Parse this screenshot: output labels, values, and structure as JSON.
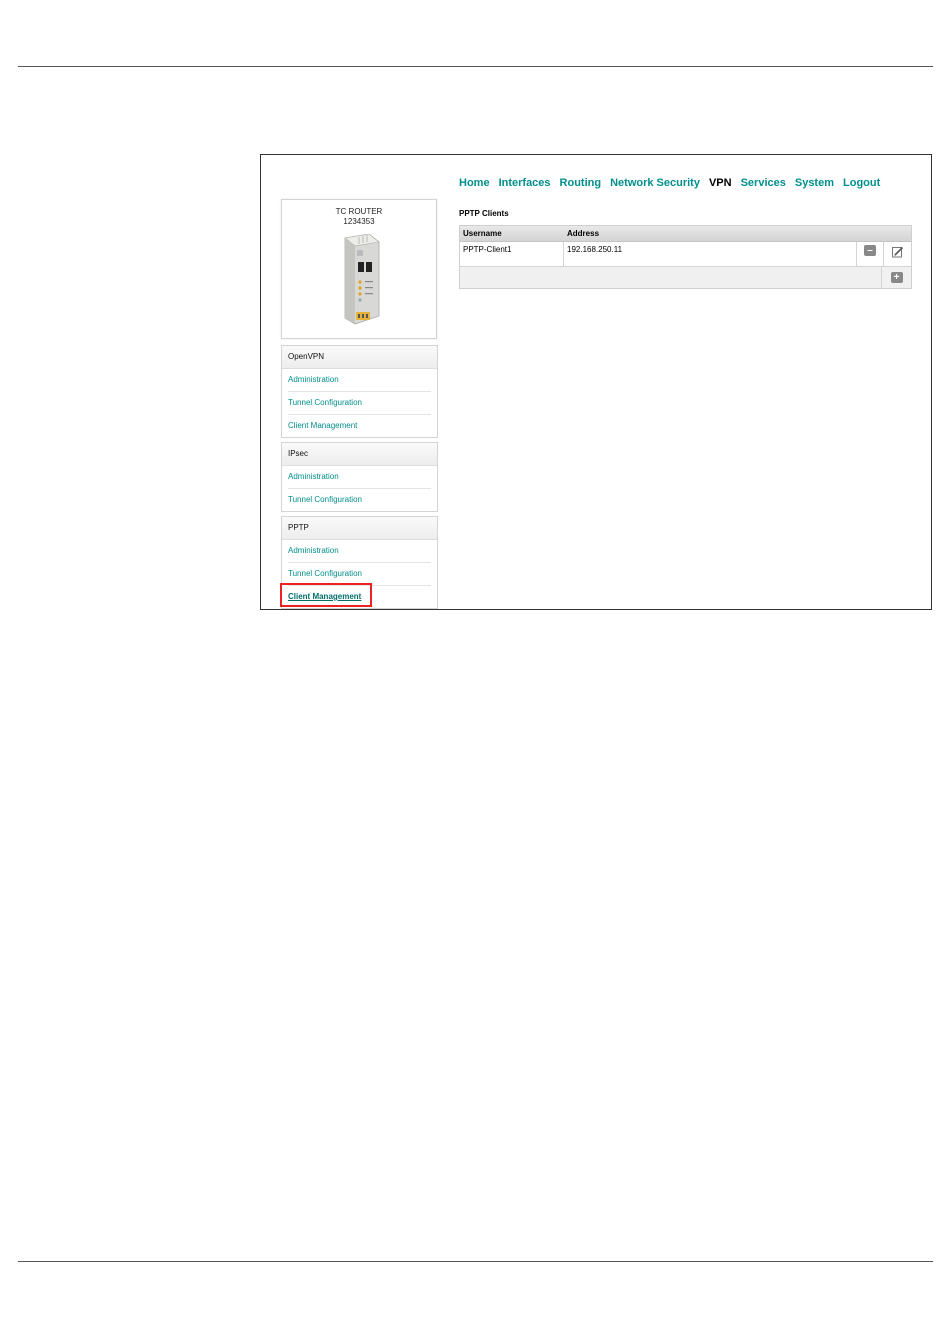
{
  "nav": {
    "items": [
      {
        "label": "Home",
        "active": false
      },
      {
        "label": "Interfaces",
        "active": false
      },
      {
        "label": "Routing",
        "active": false
      },
      {
        "label": "Network Security",
        "active": false
      },
      {
        "label": "VPN",
        "active": true
      },
      {
        "label": "Services",
        "active": false
      },
      {
        "label": "System",
        "active": false
      },
      {
        "label": "Logout",
        "active": false
      }
    ]
  },
  "device": {
    "name": "TC ROUTER",
    "number": "1234353"
  },
  "sidebar": {
    "openvpn": {
      "title": "OpenVPN",
      "items": [
        "Administration",
        "Tunnel Configuration",
        "Client Management"
      ]
    },
    "ipsec": {
      "title": "IPsec",
      "items": [
        "Administration",
        "Tunnel Configuration"
      ]
    },
    "pptp": {
      "title": "PPTP",
      "items": [
        "Administration",
        "Tunnel Configuration",
        "Client Management"
      ]
    }
  },
  "content": {
    "title": "PPTP Clients",
    "table": {
      "headers": [
        "Username",
        "Address"
      ],
      "rows": [
        {
          "username": "PPTP-Client1",
          "address": "192.168.250.11"
        }
      ]
    }
  },
  "colors": {
    "link": "#008f8c",
    "highlight": "#e22222"
  },
  "icons": [
    "remove-icon",
    "edit-icon",
    "add-icon"
  ]
}
